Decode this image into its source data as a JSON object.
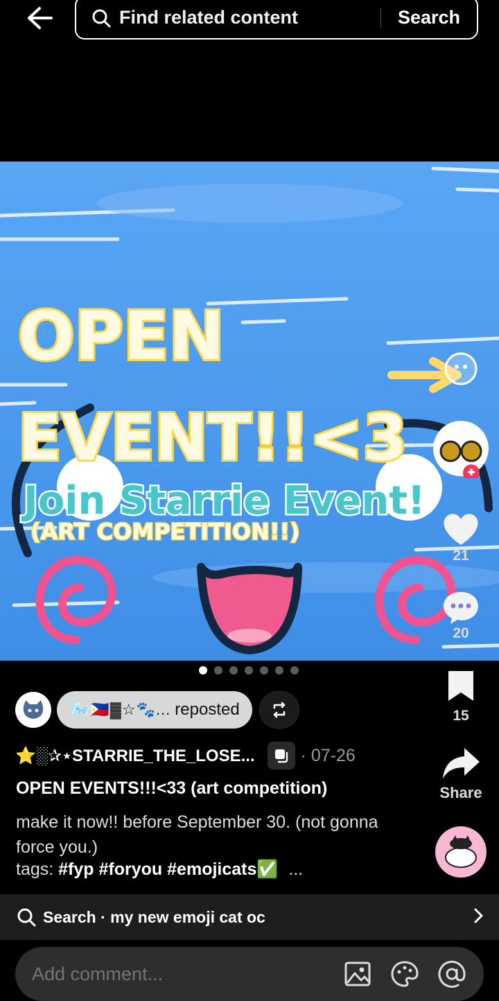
{
  "topbar": {
    "search_placeholder": "Find related content",
    "search_button": "Search"
  },
  "media": {
    "headline_line1": "OPEN",
    "headline_line2": "EVENT!!<3",
    "subtitle": "Join Starrie Event!",
    "caption": "(ART COMPETITION!!)",
    "page_count": 7,
    "active_page": 1
  },
  "rail": {
    "likes": "21",
    "comments": "20",
    "saves": "15",
    "share_label": "Share"
  },
  "repost": {
    "emojis": "🌬️🇵🇭▓☆🐾...",
    "label": "reposted"
  },
  "post": {
    "author": "⭐░✰⋆STARRIE_THE_LOSE...",
    "date": "· 07-26",
    "title": "OPEN EVENTS!!!<33 (art competition)",
    "description": "make it now!! before September 30. (not gonna force you.)",
    "tags_prefix": "tags:",
    "tags": [
      "#fyp",
      "#foryou",
      "#emojicats✅"
    ],
    "tags_more": "..."
  },
  "related_search": {
    "text": "Search · my new emoji cat oc"
  },
  "comment": {
    "placeholder": "Add comment..."
  },
  "colors": {
    "background": "#000000",
    "sky": "#4f9cf2",
    "headline_yellow": "#fff6c9",
    "subtitle_teal": "#49c6cc",
    "accent_pink": "#f0538f"
  }
}
